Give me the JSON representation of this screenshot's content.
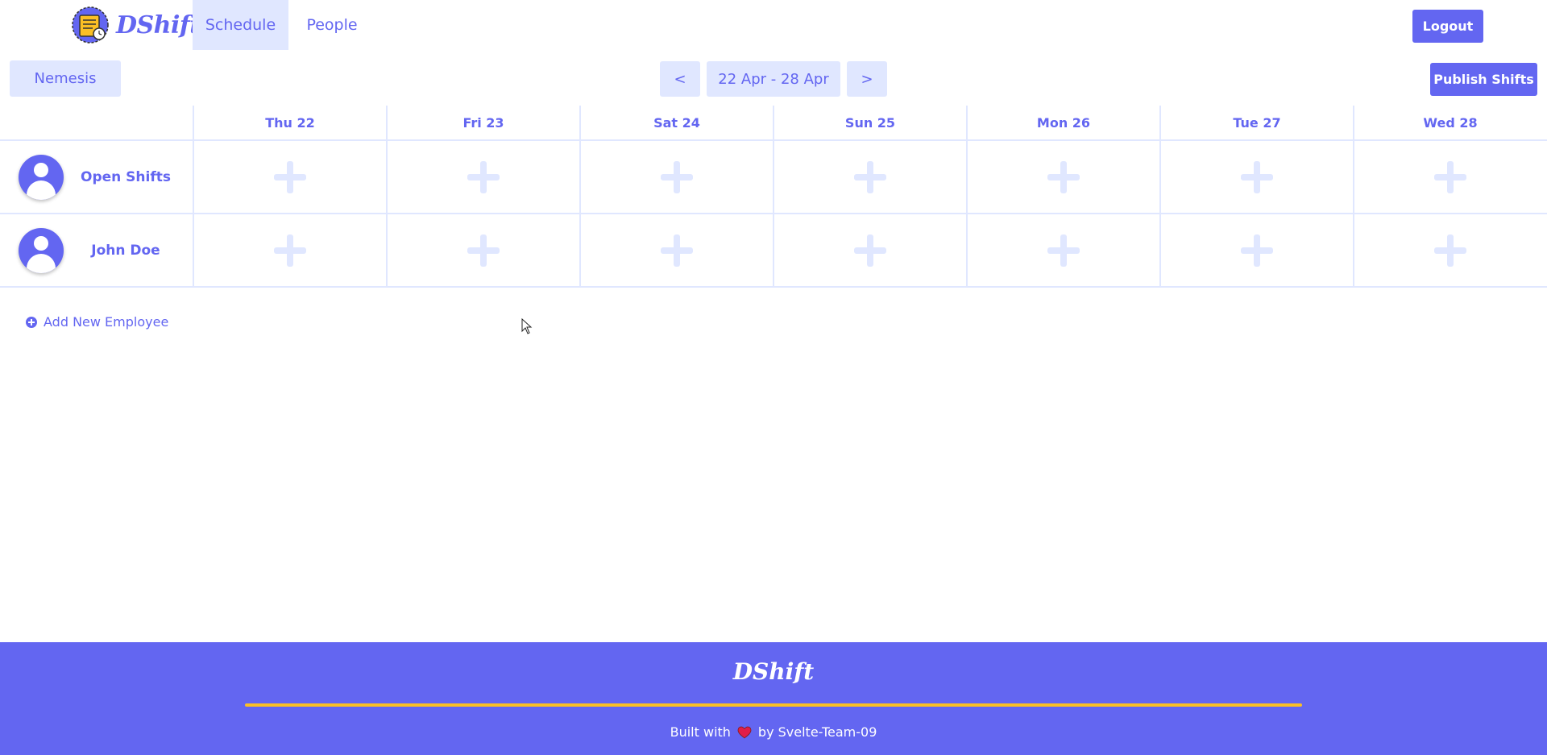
{
  "header": {
    "logo_text": "DShift",
    "tabs": [
      {
        "label": "Schedule",
        "active": true
      },
      {
        "label": "People",
        "active": false
      }
    ],
    "logout_label": "Logout"
  },
  "toolbar": {
    "location_label": "Nemesis",
    "prev_label": "<",
    "date_range": "22 Apr - 28 Apr",
    "next_label": ">",
    "publish_label": "Publish Shifts"
  },
  "schedule": {
    "days": [
      "Thu 22",
      "Fri 23",
      "Sat 24",
      "Sun 25",
      "Mon 26",
      "Tue 27",
      "Wed 28"
    ],
    "rows": [
      {
        "name": "Open Shifts",
        "icon": "user-avatar-icon"
      },
      {
        "name": "John Doe",
        "icon": "user-avatar-icon"
      }
    ],
    "add_employee_label": "Add New Employee"
  },
  "footer": {
    "logo_text": "DShift",
    "credit_prefix": "Built with",
    "credit_suffix": "by Svelte-Team-09"
  },
  "colors": {
    "primary": "#6366f1",
    "light": "#e0e7ff",
    "accent": "#fbbf24",
    "heart": "#e11d48"
  }
}
